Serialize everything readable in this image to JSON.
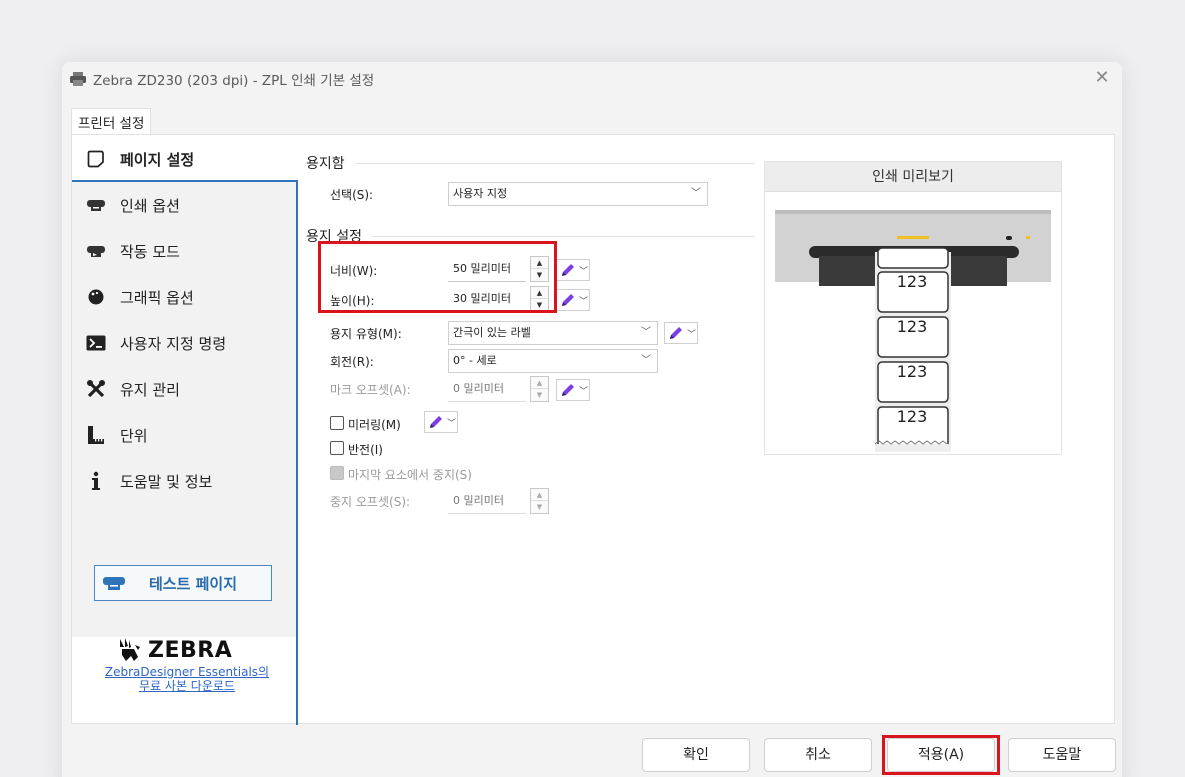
{
  "window": {
    "title": "Zebra ZD230 (203 dpi) - ZPL 인쇄 기본 설정",
    "close_glyph": "✕"
  },
  "tab": {
    "label": "프린터 설정"
  },
  "sidebar": {
    "items": [
      {
        "label": "페이지 설정",
        "icon": "page-icon",
        "active": true
      },
      {
        "label": "인쇄 옵션",
        "icon": "printer-icon"
      },
      {
        "label": "작동 모드",
        "icon": "printer-mode-icon"
      },
      {
        "label": "그래픽 옵션",
        "icon": "graphic-icon"
      },
      {
        "label": "사용자 지정 명령",
        "icon": "command-icon"
      },
      {
        "label": "유지 관리",
        "icon": "tools-icon"
      },
      {
        "label": "단위",
        "icon": "ruler-icon"
      },
      {
        "label": "도움말 및 정보",
        "icon": "info-icon"
      }
    ],
    "test_page_label": "테스트 페이지",
    "logo_text": "ZEBRA",
    "download_link_line1": "ZebraDesigner Essentials의",
    "download_link_line2": "무료 사본 다운로드"
  },
  "paper_source": {
    "title": "용지함",
    "select_label": "선택(S):",
    "select_value": "사용자 지정"
  },
  "paper_settings": {
    "title": "용지 설정",
    "width_label": "너비(W):",
    "width_value": "50 밀리미터",
    "height_label": "높이(H):",
    "height_value": "30 밀리미터",
    "media_type_label": "용지 유형(M):",
    "media_type_value": "간극이 있는 라벨",
    "rotation_label": "회전(R):",
    "rotation_value": "0° - 세로",
    "mark_offset_label": "마크 오프셋(A):",
    "mark_offset_value": "0 밀리미터",
    "mirror_label": "미러링(M)",
    "invert_label": "반전(I)",
    "stop_last_label": "마지막 요소에서 중지(S)",
    "stop_offset_label": "중지 오프셋(S):",
    "stop_offset_value": "0 밀리미터"
  },
  "preview": {
    "title": "인쇄 미리보기",
    "label_text": "123"
  },
  "buttons": {
    "ok": "확인",
    "cancel": "취소",
    "apply": "적용(A)",
    "help": "도움말"
  },
  "colors": {
    "accent_blue": "#2f74b8",
    "highlight_red": "#d8151f",
    "pen_purple": "#7b3fe4"
  }
}
